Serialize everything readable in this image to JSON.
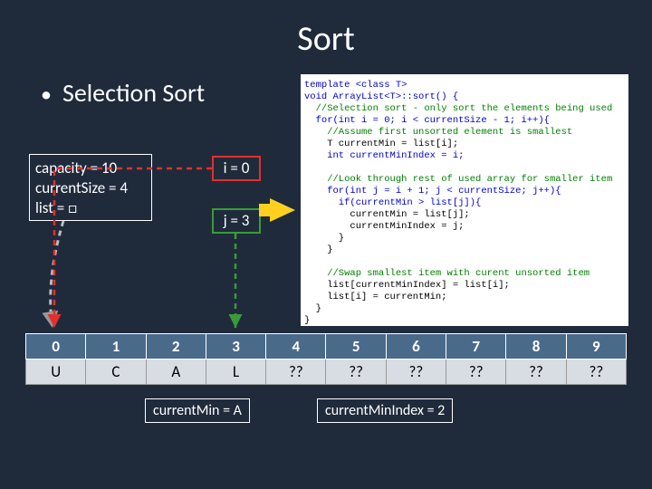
{
  "title": "Sort",
  "bullet": "Selection Sort",
  "object": {
    "l1": "capacity = 10",
    "l2": "currentSize = 4",
    "l3": "list = □"
  },
  "i_box": "i = 0",
  "j_box": "j = 3",
  "code": {
    "l1": "template <class T>",
    "l2": "void ArrayList<T>::sort() {",
    "l3": "  //Selection sort - only sort the elements being used",
    "l4": "  for(int i = 0; i < currentSize - 1; i++){",
    "l5": "    //Assume first unsorted element is smallest",
    "l6": "    T currentMin = list[i];",
    "l7": "    int currentMinIndex = i;",
    "l8": "",
    "l9": "    //Look through rest of used array for smaller item",
    "l10": "    for(int j = i + 1; j < currentSize; j++){",
    "l11": "      if(currentMin > list[j]){",
    "l12": "        currentMin = list[j];",
    "l13": "        currentMinIndex = j;",
    "l14": "      }",
    "l15": "    }",
    "l16": "",
    "l17": "    //Swap smallest item with curent unsorted item",
    "l18": "    list[currentMinIndex] = list[i];",
    "l19": "    list[i] = currentMin;",
    "l20": "  }",
    "l21": "}"
  },
  "table": {
    "indices": [
      "0",
      "1",
      "2",
      "3",
      "4",
      "5",
      "6",
      "7",
      "8",
      "9"
    ],
    "values": [
      "U",
      "C",
      "A",
      "L",
      "??",
      "??",
      "??",
      "??",
      "??",
      "??"
    ]
  },
  "currentMin": "currentMin = A",
  "currentMinIndex": "currentMinIndex = 2"
}
